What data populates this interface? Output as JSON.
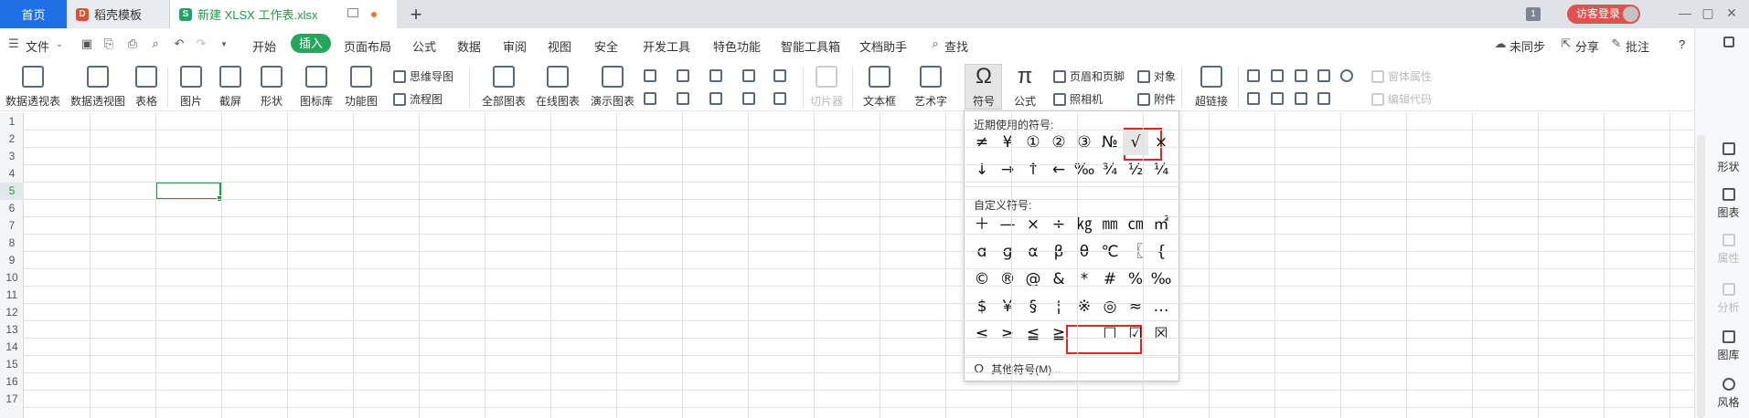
{
  "tabs": {
    "home": "首页",
    "templates": "稻壳模板",
    "file": "新建 XLSX 工作表.xlsx",
    "new_tab": "+"
  },
  "titlebar": {
    "page_badge": "1",
    "login": "访客登录",
    "window_buttons": [
      "—",
      "▢",
      "✕"
    ]
  },
  "menubar": {
    "file": "文件",
    "items": [
      "开始",
      "插入",
      "页面布局",
      "公式",
      "数据",
      "审阅",
      "视图",
      "安全",
      "开发工具",
      "特色功能",
      "智能工具箱",
      "文档助手"
    ],
    "search": "查找",
    "unsync": "未同步",
    "share": "分享",
    "comment": "批注",
    "help": "?"
  },
  "ribbon": {
    "pivot_table": "数据透视表",
    "pivot_chart": "数据透视图",
    "table": "表格",
    "picture": "图片",
    "screenshot": "截屏",
    "shapes": "形状",
    "icon_library": "图标库",
    "function_chart": "功能图",
    "mindmap": "思维导图",
    "flowchart": "流程图",
    "all_charts": "全部图表",
    "online_chart": "在线图表",
    "demo_chart": "演示图表",
    "slicer": "切片器",
    "textbox": "文本框",
    "wordart": "艺术字",
    "symbol": "符号",
    "formula": "公式",
    "header_footer": "页眉和页脚",
    "object": "对象",
    "camera": "照相机",
    "attachment": "附件",
    "hyperlink": "超链接",
    "form_properties": "窗体属性",
    "edit_code": "编辑代码"
  },
  "rows": [
    "1",
    "2",
    "3",
    "4",
    "5",
    "6",
    "7",
    "8",
    "9",
    "10",
    "11",
    "12",
    "13",
    "14",
    "15",
    "16",
    "17"
  ],
  "active_cell_row": 5,
  "sidepanel": {
    "shape": "形状",
    "chart": "图表",
    "property": "属性",
    "analysis": "分析",
    "gallery": "图库",
    "style": "风格"
  },
  "symbol_dropdown": {
    "recent_title": "近期使用的符号:",
    "recent": [
      [
        "≠",
        "¥",
        "①",
        "②",
        "③",
        "№",
        "√",
        "×"
      ],
      [
        "↓",
        "→",
        "↑",
        "←",
        "‰",
        "¾",
        "½",
        "¼"
      ]
    ],
    "custom_title": "自定义符号:",
    "custom": [
      [
        "＋",
        "—",
        "×",
        "÷",
        "㎏",
        "㎜",
        "㎝",
        "㎡"
      ],
      [
        "ɑ",
        "ɡ",
        "α",
        "β",
        "θ",
        "℃",
        "〖",
        "{"
      ],
      [
        "©",
        "®",
        "@",
        "&",
        "*",
        "#",
        "%",
        "‰"
      ],
      [
        "$",
        "￥",
        "§",
        "¦",
        "※",
        "◎",
        "≈",
        "…"
      ],
      [
        "≤",
        "≥",
        "≦",
        "≧",
        "",
        "☐",
        "☑",
        "☒"
      ]
    ],
    "more": "其他符号(M)..."
  }
}
